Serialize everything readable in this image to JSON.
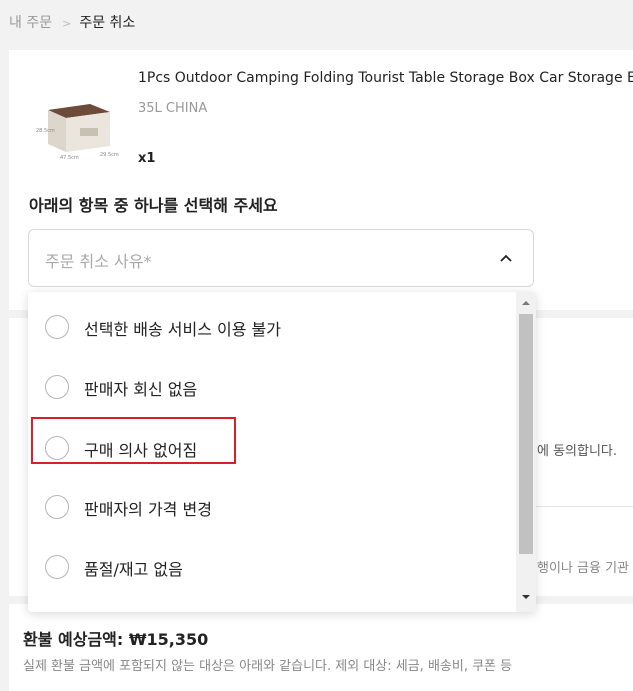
{
  "breadcrumb": {
    "parent": "내 주문",
    "separator": ">",
    "current": "주문 취소"
  },
  "product": {
    "title": "1Pcs Outdoor Camping Folding Tourist Table Storage Box Car Storage E",
    "variant": "35L CHINA",
    "quantity": "x1"
  },
  "prompt": "아래의 항목 중 하나를 선택해 주세요",
  "reason_select": {
    "placeholder": "주문 취소 사유*",
    "icon": "chevron-up-icon"
  },
  "reasons": [
    {
      "label": "선택한 배송 서비스 이용 불가",
      "selected": false,
      "highlighted": false
    },
    {
      "label": "판매자 회신 없음",
      "selected": false,
      "highlighted": false
    },
    {
      "label": "구매 의사 없어짐",
      "selected": false,
      "highlighted": true
    },
    {
      "label": "판매자의 가격 변경",
      "selected": false,
      "highlighted": false
    },
    {
      "label": "품절/재고 없음",
      "selected": false,
      "highlighted": false
    }
  ],
  "background_fragments": {
    "agree_text": "에 동의합니다.",
    "bank_text": "행이나 금융 기관"
  },
  "refund": {
    "label": "환불 예상금액: ₩15,350",
    "note": "실제 환불 금액에 포함되지 않는 대상은 아래와 같습니다. 제외 대상: 세금, 배송비, 쿠폰 등"
  },
  "colors": {
    "highlight": "#d8202a",
    "scrollbar_thumb": "#c1c1c1"
  }
}
